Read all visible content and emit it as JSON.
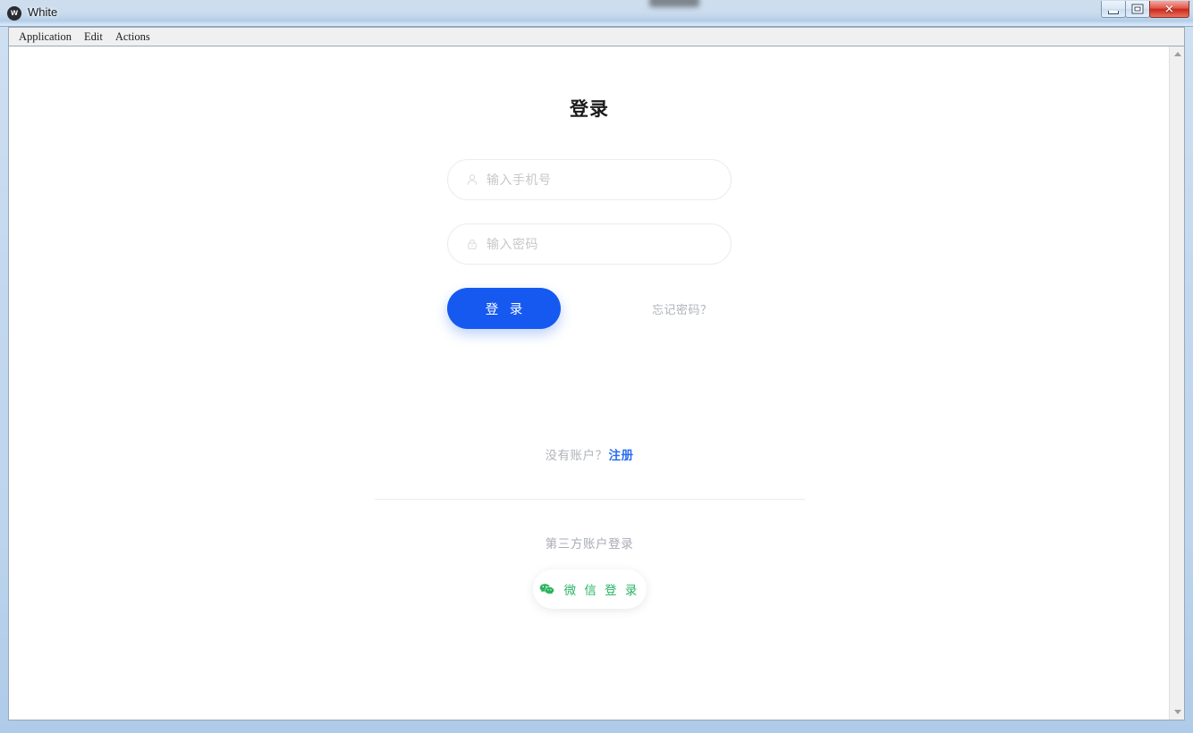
{
  "window": {
    "app_icon_letter": "w",
    "title": "White",
    "controls": {
      "minimize": "Minimize",
      "maximize": "Maximize",
      "close": "✕"
    }
  },
  "menubar": {
    "items": [
      {
        "label": "Application"
      },
      {
        "label": "Edit"
      },
      {
        "label": "Actions"
      }
    ]
  },
  "scrollbar": {
    "up_arrow": "scroll-up",
    "down_arrow": "scroll-down"
  },
  "login": {
    "title": "登录",
    "fields": [
      {
        "icon": "user-icon",
        "placeholder": "输入手机号",
        "value": ""
      },
      {
        "icon": "lock-icon",
        "placeholder": "输入密码",
        "value": ""
      }
    ],
    "submit_label": "登 录",
    "forgot_label": "忘记密码？",
    "register_prompt": "没有账户？",
    "register_link": "注册",
    "divider": true,
    "third_party_label": "第三方账户登录",
    "wechat": {
      "icon": "wechat-icon",
      "label": "微 信 登 录"
    }
  },
  "colors": {
    "primary_blue": "#1659f0",
    "link_blue": "#2b6ef0",
    "wechat_green": "#29b463",
    "muted_gray": "#b0b3bb",
    "placeholder_gray": "#c7c7c7",
    "border_gray": "#ececec"
  }
}
